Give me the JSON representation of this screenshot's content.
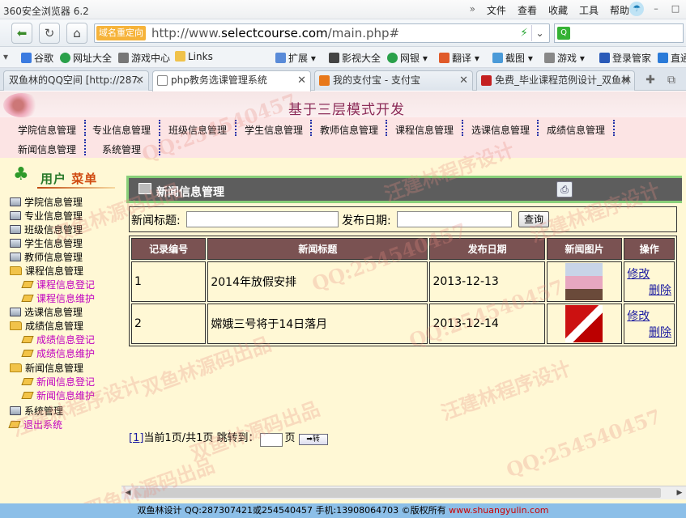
{
  "browser": {
    "app_title": "360安全浏览器 6.2",
    "menus": [
      "文件",
      "查看",
      "收藏",
      "工具",
      "帮助"
    ],
    "redirect_label": "域名重定向",
    "url_prefix": "http://www.",
    "url_domain": "selectcourse.com",
    "url_path": "/main.php#",
    "favorites": [
      "谷歌",
      "网址大全",
      "游戏中心",
      "Links",
      "扩展",
      "影视大全",
      "网银",
      "翻译",
      "截图",
      "游戏",
      "登录管家",
      "直通"
    ],
    "tabs": [
      {
        "label": "双鱼林的QQ空间 [http://287:"
      },
      {
        "label": "php教务选课管理系统"
      },
      {
        "label": "我的支付宝 - 支付宝"
      },
      {
        "label": "免费_毕业课程范例设计_双鱼林"
      }
    ]
  },
  "header": {
    "subtitle": "基于三层模式开发"
  },
  "topnav": {
    "items": [
      "学院信息管理",
      "专业信息管理",
      "班级信息管理",
      "学生信息管理",
      "教师信息管理",
      "课程信息管理",
      "选课信息管理",
      "成绩信息管理",
      "新闻信息管理",
      "系统管理"
    ]
  },
  "sidebar": {
    "title_a": "用户",
    "title_b": "菜单",
    "items": [
      "学院信息管理",
      "专业信息管理",
      "班级信息管理",
      "学生信息管理",
      "教师信息管理",
      "课程信息管理",
      "课程信息登记",
      "课程信息维护",
      "选课信息管理",
      "成绩信息管理",
      "成绩信息登记",
      "成绩信息维护",
      "新闻信息管理",
      "新闻信息登记",
      "新闻信息维护",
      "系统管理",
      "退出系统"
    ]
  },
  "main": {
    "title": "新闻信息管理",
    "search": {
      "title_label": "新闻标题:",
      "date_label": "发布日期:",
      "title_value": "",
      "date_value": "",
      "button": "查询"
    },
    "table": {
      "headers": [
        "记录编号",
        "新闻标题",
        "发布日期",
        "新闻图片",
        "操作"
      ],
      "rows": [
        {
          "id": "1",
          "title": "2014年放假安排",
          "date": "2013-12-13",
          "edit": "修改",
          "delete": "删除"
        },
        {
          "id": "2",
          "title": "嫦娥三号将于14日落月",
          "date": "2013-12-14",
          "edit": "修改",
          "delete": "删除"
        }
      ]
    },
    "pager": {
      "page_link": "[1]",
      "info": "当前1页/共1页 跳转到：",
      "page_unit": "页",
      "go_label": "➡转"
    }
  },
  "footer": {
    "text": "双鱼林设计 QQ:287307421或254540457 手机:13908064703 ©版权所有 ",
    "site": "www.shuangyulin.com"
  },
  "watermarks": [
    "QQ:254540457",
    "汪建林程序设计",
    "双鱼林源码出品",
    "QQ:254540457",
    "汪建林程序设计",
    "双鱼林源码出品",
    "QQ:254540457",
    "汪建林程序设计",
    "双鱼林源码出品",
    "QQ:254540457",
    "汪建林程序设计",
    "双鱼林源码出品"
  ],
  "colors": {
    "page_bg": "#fff8d5",
    "nav_bg": "#fce4e4",
    "table_header": "#7a5252",
    "panel_head": "#5d5d5d",
    "panel_border": "#88cf79",
    "footer_bg": "#8cbfe8"
  }
}
